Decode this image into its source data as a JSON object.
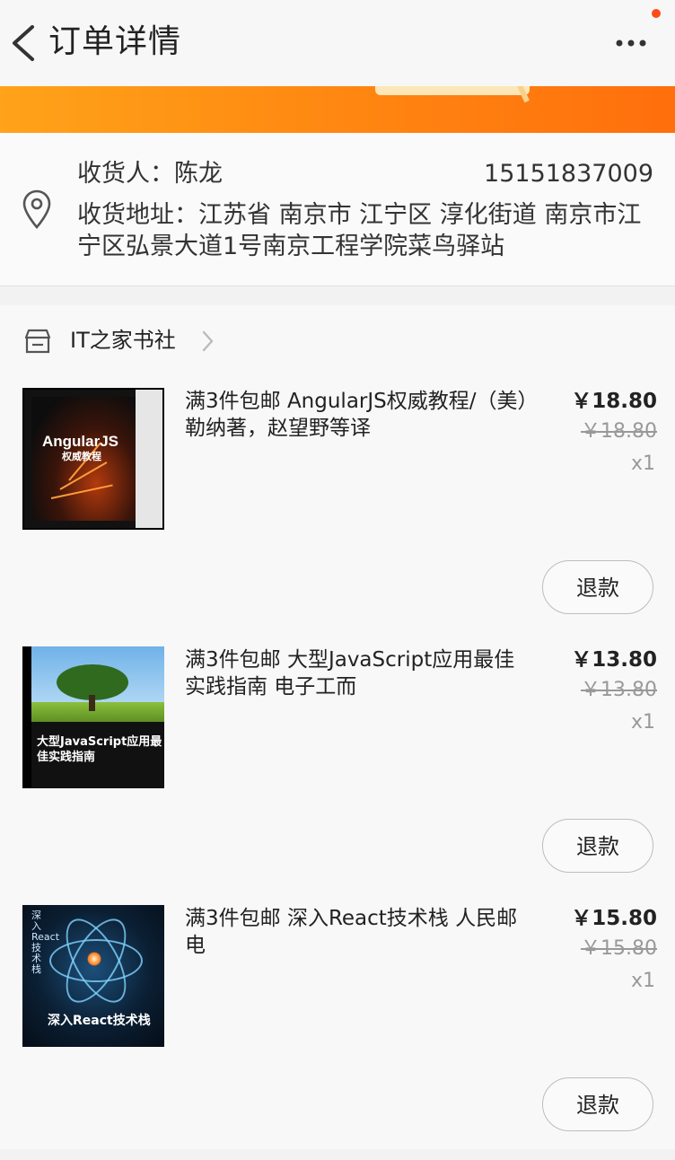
{
  "header": {
    "title": "订单详情"
  },
  "address": {
    "receiver": "收货人：陈龙",
    "phone": "15151837009",
    "full_address": "收货地址：江苏省 南京市 江宁区 淳化街道 南京市江宁区弘景大道1号南京工程学院菜鸟驿站"
  },
  "shop": {
    "name": "IT之家书社"
  },
  "items": [
    {
      "title": "满3件包邮 AngularJS权威教程/（美）勒纳著，赵望野等译",
      "price": "￥18.80",
      "original_price": "￥18.80",
      "quantity": "x1",
      "refund_label": "退款",
      "cover_title": "AngularJS",
      "cover_subtitle": "权威教程"
    },
    {
      "title": "满3件包邮 大型JavaScript应用最佳实践指南 电子工而",
      "price": "￥13.80",
      "original_price": "￥13.80",
      "quantity": "x1",
      "refund_label": "退款",
      "cover_title": "大型JavaScript应用最佳实践指南"
    },
    {
      "title": "满3件包邮 深入React技术栈 人民邮电",
      "price": "￥15.80",
      "original_price": "￥15.80",
      "quantity": "x1",
      "refund_label": "退款",
      "cover_title": "深入React技术栈",
      "cover_side_text": "深入React技术栈"
    }
  ],
  "colors": {
    "banner_start": "#ffa319",
    "banner_end": "#ff6f0c",
    "badge": "#ff4a1a"
  },
  "icons": [
    "back-arrow-icon",
    "more-dots-icon",
    "location-pin-icon",
    "shop-icon",
    "chevron-right-icon"
  ]
}
